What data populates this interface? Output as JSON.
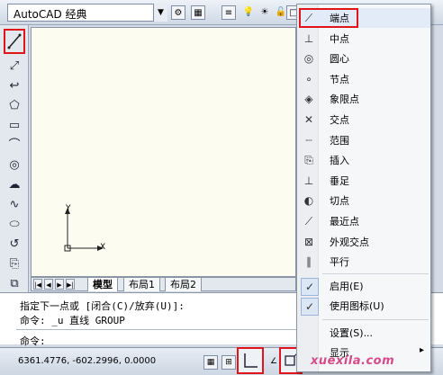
{
  "workspace": {
    "value": "AutoCAD 经典"
  },
  "menu": {
    "items": [
      {
        "label": "端点",
        "icon": "endpoint-icon"
      },
      {
        "label": "中点",
        "icon": "midpoint-icon"
      },
      {
        "label": "圆心",
        "icon": "center-icon"
      },
      {
        "label": "节点",
        "icon": "node-icon"
      },
      {
        "label": "象限点",
        "icon": "quadrant-icon"
      },
      {
        "label": "交点",
        "icon": "intersection-icon"
      },
      {
        "label": "范围",
        "icon": "extension-icon"
      },
      {
        "label": "插入",
        "icon": "insert-icon"
      },
      {
        "label": "垂足",
        "icon": "perpendicular-icon"
      },
      {
        "label": "切点",
        "icon": "tangent-icon"
      },
      {
        "label": "最近点",
        "icon": "nearest-icon"
      },
      {
        "label": "外观交点",
        "icon": "apparent-intersection-icon"
      },
      {
        "label": "平行",
        "icon": "parallel-icon"
      }
    ],
    "toggles": [
      {
        "label": "启用(E)",
        "checked": true
      },
      {
        "label": "使用图标(U)",
        "checked": true
      }
    ],
    "settings_label": "设置(S)...",
    "display_label": "显示",
    "display_arrow": "▸"
  },
  "tabs": [
    "模型",
    "布局1",
    "布局2"
  ],
  "ucs": {
    "y_label": "Y",
    "x_label": "X"
  },
  "command": {
    "line1": "指定下一点或 [闭合(C)/放弃(U)]:",
    "line2": "命令: _u 直线 GROUP",
    "prompt": "命令:"
  },
  "status": {
    "coords": "6361.4776, -602.2996, 0.0000"
  },
  "watermark": "xuexila.com",
  "colors": {
    "highlight_red": "#e0141b",
    "canvas_bg": "#fdfcf0"
  }
}
